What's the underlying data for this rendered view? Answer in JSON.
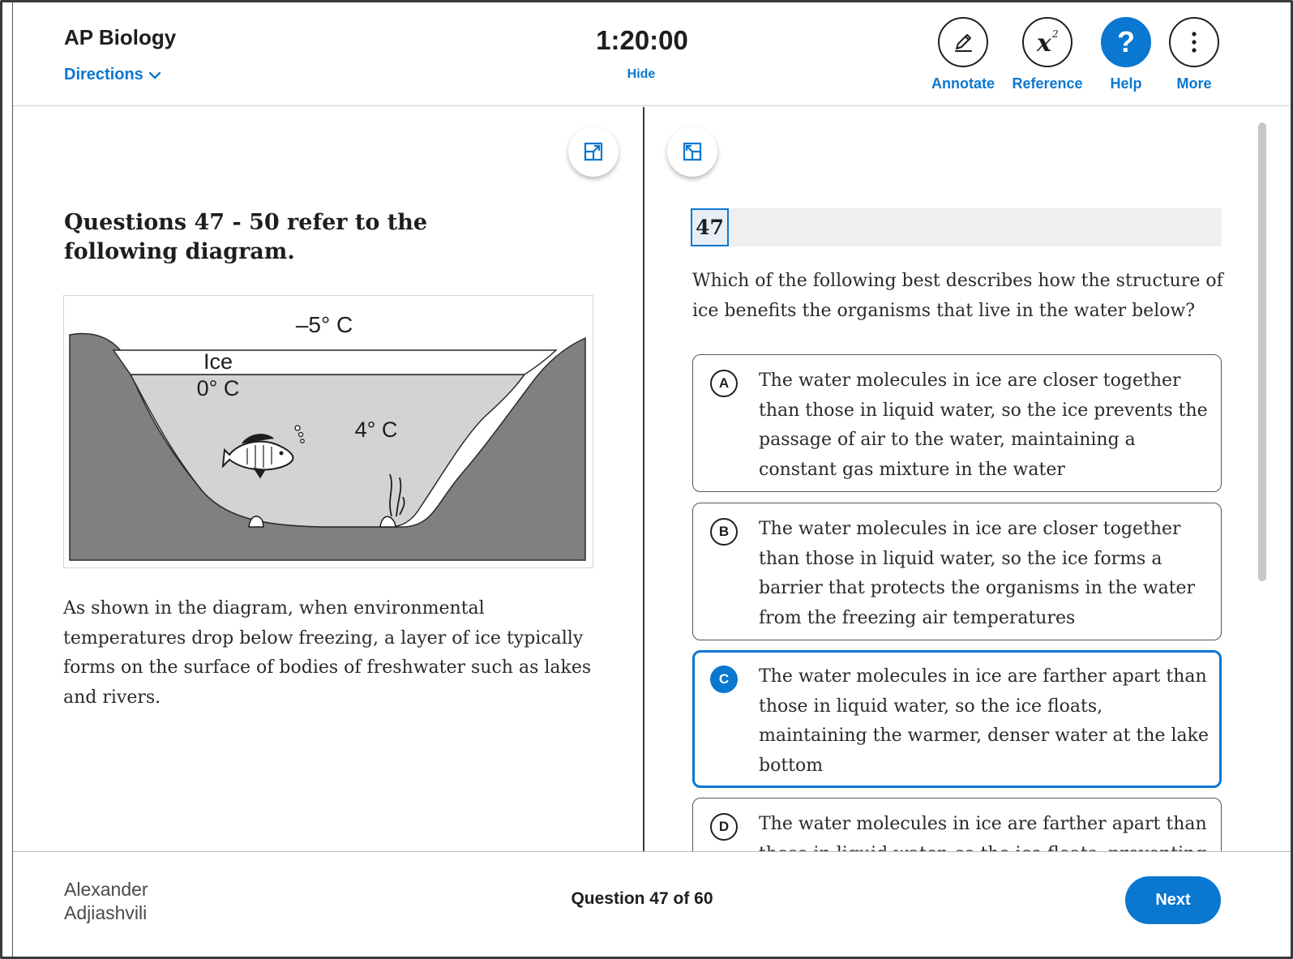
{
  "header": {
    "title": "AP Biology",
    "directions_label": "Directions",
    "timer": "1:20:00",
    "hide_label": "Hide",
    "tools": {
      "annotate": "Annotate",
      "reference": "Reference",
      "help": "Help",
      "more": "More"
    }
  },
  "passage": {
    "title": "Questions 47 - 50 refer to the following diagram.",
    "figure": {
      "air_temp": "–5° C",
      "ice_label": "Ice",
      "ice_temp": "0° C",
      "water_temp": "4° C"
    },
    "text": "As shown in the diagram, when environmental temperatures drop below freezing, a layer of ice typically forms on the surface of bodies of freshwater such as lakes and rivers."
  },
  "question": {
    "number": "47",
    "stem": "Which of the following best describes how the structure of ice benefits the organisms that live in the water below?",
    "selected": "C",
    "choices": [
      {
        "letter": "A",
        "text": "The water molecules in ice are closer together than those in liquid water, so the ice prevents the passage of air to the water, maintaining a constant gas mixture in the water"
      },
      {
        "letter": "B",
        "text": "The water molecules in ice are closer together than those in liquid water, so the ice forms a barrier that protects the organisms in the water from the freezing air temperatures"
      },
      {
        "letter": "C",
        "text": "The water molecules in ice are farther apart than those in liquid water, so the ice floats, maintaining the warmer, denser water at the lake bottom"
      },
      {
        "letter": "D",
        "text": "The water molecules in ice are farther apart than those in liquid water, so the ice floats, preventing"
      }
    ]
  },
  "footer": {
    "student_name": "Alexander Adjiashvili",
    "progress": "Question 47 of 60",
    "next_label": "Next"
  },
  "colors": {
    "accent": "#0a77d0",
    "terrain": "#808083",
    "water": "#d3d3d5"
  }
}
